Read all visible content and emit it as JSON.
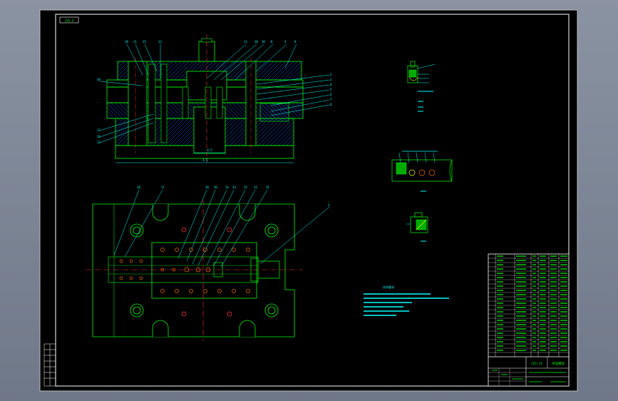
{
  "sheet": {
    "background": "#000000",
    "line_colors": {
      "outline": "#00ff00",
      "leader": "#00ffff",
      "center": "#ff3333",
      "hatch": "#0066ff",
      "frame": "#ffffff"
    }
  },
  "drawing": {
    "tag_top_left": "JS5-4",
    "dimension_mid": "4.5",
    "dimension_bottom": "4.5",
    "title_block": {
      "code": "JS5-11",
      "name": "冲压模具"
    },
    "notes_heading": "技术要求"
  }
}
